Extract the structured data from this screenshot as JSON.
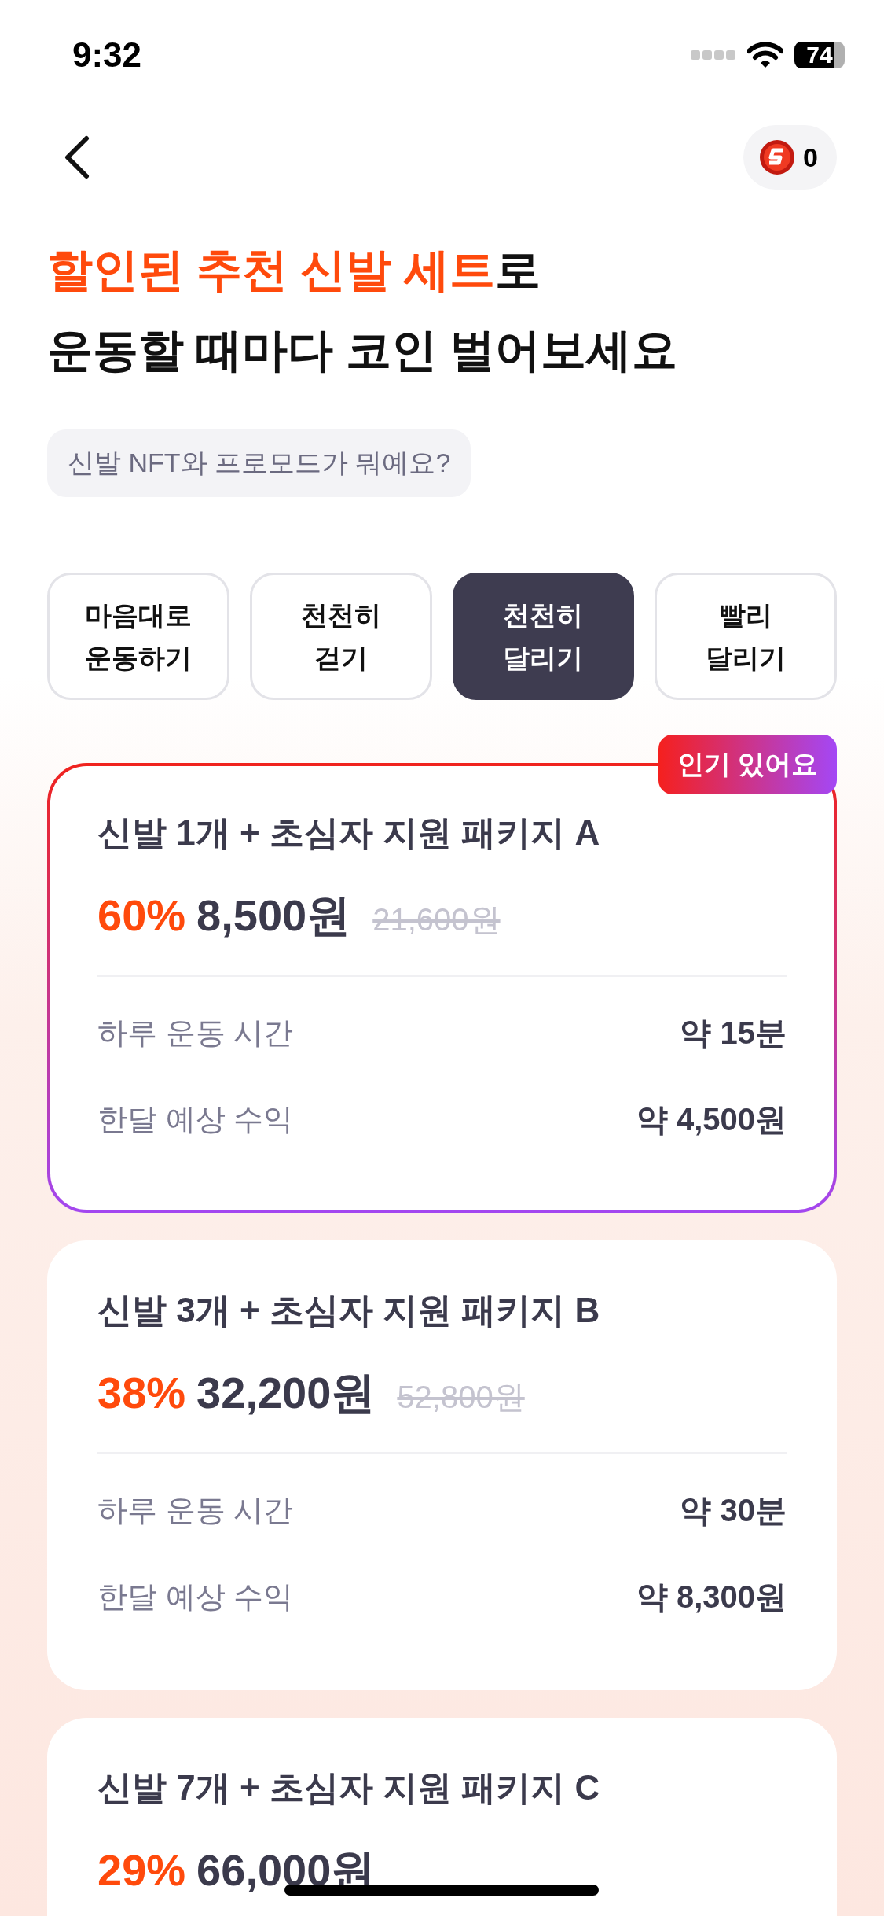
{
  "status_bar": {
    "time": "9:32",
    "battery": "74"
  },
  "header": {
    "coins": "0"
  },
  "title": {
    "highlight": "할인된 추천 신발 세트",
    "highlight_rest": "로",
    "line2": "운동할 때마다 코인 벌어보세요"
  },
  "help_chip": "신발 NFT와 프로모드가 뭐예요?",
  "tabs": [
    {
      "line1": "마음대로",
      "line2": "운동하기",
      "selected": false
    },
    {
      "line1": "천천히",
      "line2": "걷기",
      "selected": false
    },
    {
      "line1": "천천히",
      "line2": "달리기",
      "selected": true
    },
    {
      "line1": "빨리",
      "line2": "달리기",
      "selected": false
    }
  ],
  "packages": [
    {
      "featured": true,
      "badge": "인기 있어요",
      "name": "신발 1개 + 초심자 지원 패키지 A",
      "discount": "60%",
      "price": "8,500원",
      "original_price": "21,600원",
      "rows": [
        {
          "label": "하루 운동 시간",
          "value": "약 15분"
        },
        {
          "label": "한달 예상 수익",
          "value": "약 4,500원"
        }
      ]
    },
    {
      "featured": false,
      "name": "신발 3개 + 초심자 지원 패키지 B",
      "discount": "38%",
      "price": "32,200원",
      "original_price": "52,800원",
      "rows": [
        {
          "label": "하루 운동 시간",
          "value": "약 30분"
        },
        {
          "label": "한달 예상 수익",
          "value": "약 8,300원"
        }
      ]
    },
    {
      "featured": false,
      "name": "신발 7개 + 초심자 지원 패키지 C",
      "discount": "29%",
      "price": "66,000원"
    }
  ]
}
